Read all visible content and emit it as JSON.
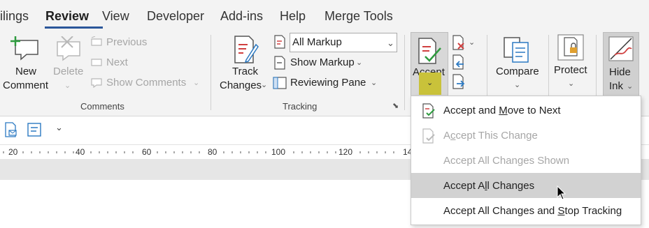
{
  "tabs": [
    {
      "label": "ilings"
    },
    {
      "label": "Review"
    },
    {
      "label": "View"
    },
    {
      "label": "Developer"
    },
    {
      "label": "Add-ins"
    },
    {
      "label": "Help"
    },
    {
      "label": "Merge Tools"
    }
  ],
  "comments_group": {
    "new_comment": [
      "New",
      "Comment"
    ],
    "delete": "Delete",
    "previous": "Previous",
    "next": "Next",
    "show_comments": "Show Comments",
    "group_label": "Comments"
  },
  "tracking_group": {
    "track_changes": [
      "Track",
      "Changes"
    ],
    "markup_select": "All Markup",
    "show_markup": "Show Markup",
    "reviewing_pane": "Reviewing Pane",
    "group_label": "Tracking"
  },
  "accept_group": {
    "accept": "Accept"
  },
  "compare_group": {
    "compare": "Compare"
  },
  "protect_group": {
    "protect": "Protect"
  },
  "ink_group": {
    "hide_ink": [
      "Hide",
      "Ink"
    ]
  },
  "ruler": [
    "20",
    "40",
    "60",
    "80",
    "100",
    "120",
    "14"
  ],
  "accept_menu": {
    "items": [
      {
        "pre": "Accept and ",
        "u": "M",
        "post": "ove to Next",
        "disabled": false
      },
      {
        "pre": "A",
        "u": "c",
        "post": "cept This Change",
        "disabled": true
      },
      {
        "pre": "Accept All Changes Shown",
        "u": "",
        "post": "",
        "disabled": true
      },
      {
        "pre": "Accept A",
        "u": "l",
        "post": "l Changes",
        "disabled": false
      },
      {
        "pre": "Accept All Changes and ",
        "u": "S",
        "post": "top Tracking",
        "disabled": false
      }
    ]
  },
  "colors": {
    "accent": "#2b579a",
    "accept_highlight": "#c9c23a",
    "ribbon_bg": "#f3f3f3"
  }
}
